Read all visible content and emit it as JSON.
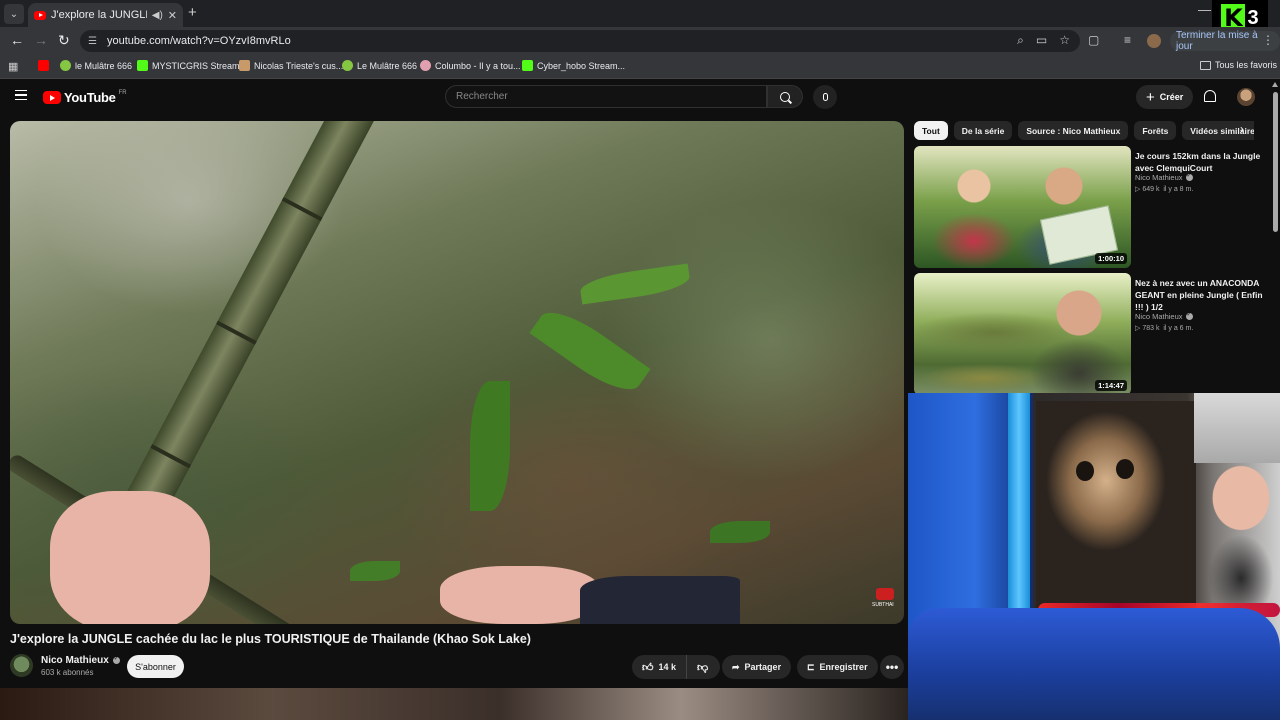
{
  "browser": {
    "tab_title": "J'explore la JUNGLE cachée",
    "url": "youtube.com/watch?v=OYzvI8mvRLo",
    "update_label": "Terminer la mise à jour",
    "bookmarks": [
      {
        "label": "",
        "icon": "youtube-icon",
        "color": "#ff0000"
      },
      {
        "label": "le Mulâtre 666",
        "icon": "rumble-icon",
        "color": "#85c742"
      },
      {
        "label": "MYSTICGRIS Stream...",
        "icon": "kick-icon",
        "color": "#53fc18"
      },
      {
        "label": "Nicolas Trieste's cus...",
        "icon": "mask-icon",
        "color": "#c89a6a"
      },
      {
        "label": "Le Mulâtre 666",
        "icon": "rumble-icon",
        "color": "#85c742"
      },
      {
        "label": "Columbo - Il y a tou...",
        "icon": "columbo-icon",
        "color": "#e0a0b0"
      },
      {
        "label": "Cyber_hobo Stream...",
        "icon": "kick-icon",
        "color": "#53fc18"
      }
    ],
    "all_bookmarks_label": "Tous les favoris"
  },
  "overlay": {
    "kick_letter": "K",
    "kick_number": "3"
  },
  "masthead": {
    "logo_text": "YouTube",
    "logo_region": "FR",
    "search_placeholder": "Rechercher",
    "create_label": "Créer"
  },
  "video": {
    "title": "J'explore la JUNGLE cachée du lac le plus TOURISTIQUE de Thailande (Khao Sok Lake)",
    "channel": "Nico Mathieux",
    "subscribers": "603 k abonnés",
    "subscribe_label": "S'abonner",
    "likes": "14 k",
    "share_label": "Partager",
    "save_label": "Enregistrer",
    "watermark": "SUBTHAI"
  },
  "chips": [
    "Tout",
    "De la série",
    "Source : Nico Mathieux",
    "Forêts",
    "Vidéos similaires"
  ],
  "recommendations": [
    {
      "title": "Je cours 152km dans la Jungle avec ClemquiCourt",
      "channel": "Nico Mathieux",
      "views": "649 k",
      "age": "il y a 8 m.",
      "duration": "1:00:10"
    },
    {
      "title": "Nez à nez avec un ANACONDA GEANT en pleine Jungle ( Enfin !!! ) 1/2",
      "channel": "Nico Mathieux",
      "views": "783 k",
      "age": "il y a 6 m.",
      "duration": "1:14:47"
    }
  ],
  "colors": {
    "accent": "#ff0000",
    "background": "#0f0f0f",
    "kick_green": "#53fc18"
  }
}
